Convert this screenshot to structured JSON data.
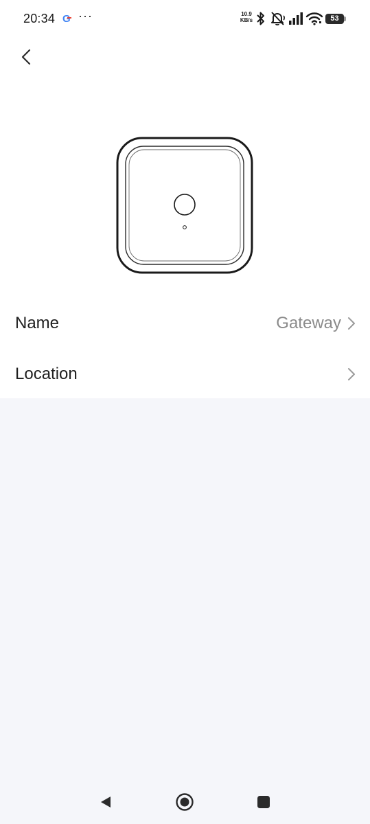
{
  "status_bar": {
    "time": "20:34",
    "google_icon": "G",
    "more_indicator": "···",
    "net_speed_value": "10.9",
    "net_speed_unit": "KB/s",
    "battery_level": "53",
    "icons": [
      "google-icon",
      "bluetooth-icon",
      "mute-icon",
      "signal-icon",
      "wifi-icon",
      "battery-icon"
    ]
  },
  "header": {
    "back_icon": "chevron-left-icon"
  },
  "device": {
    "image_icon": "gateway-device-icon"
  },
  "settings": {
    "rows": [
      {
        "label": "Name",
        "value": "Gateway",
        "icon": "chevron-right-icon"
      },
      {
        "label": "Location",
        "value": "",
        "icon": "chevron-right-icon"
      }
    ]
  },
  "nav_bar": {
    "icons": [
      "back-triangle-icon",
      "home-circle-icon",
      "recents-square-icon"
    ]
  },
  "colors": {
    "content_background": "#ffffff",
    "page_background": "#f5f6fa",
    "primary_text": "#1f1f1f",
    "secondary_text": "#8a8a8a"
  }
}
